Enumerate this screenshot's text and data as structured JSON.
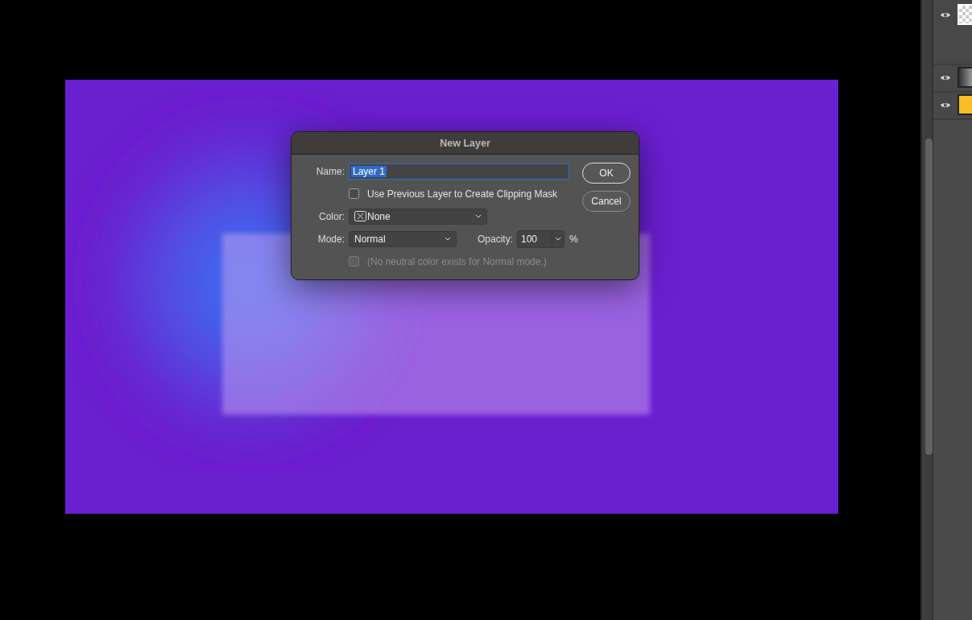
{
  "dialog": {
    "title": "New Layer",
    "name_label": "Name:",
    "name_value": "Layer 1",
    "name_selected": true,
    "clipping": {
      "label": "Use Previous Layer to Create Clipping Mask",
      "checked": false
    },
    "color_label": "Color:",
    "color_value": "None",
    "mode_label": "Mode:",
    "mode_value": "Normal",
    "opacity_label": "Opacity:",
    "opacity_value": "100",
    "opacity_unit": "%",
    "neutral": {
      "label": "(No neutral color exists for Normal mode.)",
      "checked": false,
      "disabled": true
    },
    "buttons": [
      {
        "label": "OK",
        "selected": true
      },
      {
        "label": "Cancel",
        "selected": false
      }
    ]
  },
  "layers": [
    {
      "visible": true,
      "kind": "transparent"
    },
    {
      "visible": true,
      "kind": "gradient"
    },
    {
      "visible": true,
      "kind": "solid",
      "color": "#f9bd25"
    }
  ]
}
